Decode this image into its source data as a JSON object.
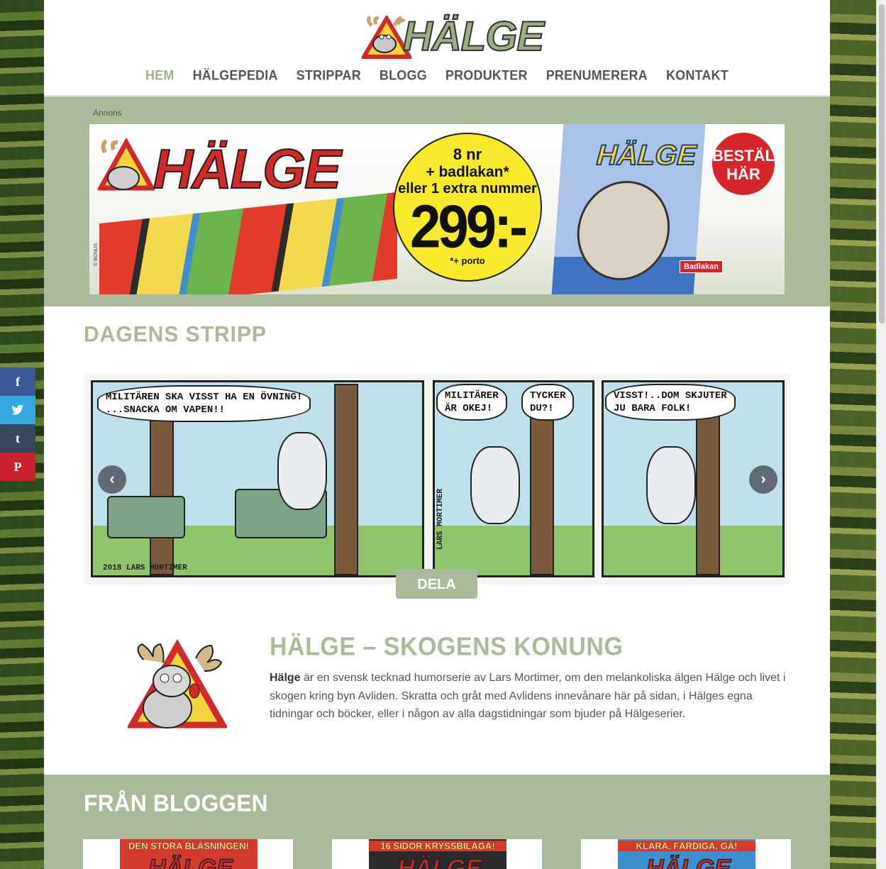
{
  "site": {
    "logo_text": "HÄLGE",
    "nav": [
      {
        "label": "HEM",
        "active": true
      },
      {
        "label": "HÄLGEPEDIA",
        "active": false
      },
      {
        "label": "STRIPPAR",
        "active": false
      },
      {
        "label": "BLOGG",
        "active": false
      },
      {
        "label": "PRODUKTER",
        "active": false
      },
      {
        "label": "PRENUMERERA",
        "active": false
      },
      {
        "label": "KONTAKT",
        "active": false
      }
    ]
  },
  "ad": {
    "label": "Annons",
    "logo_text": "HÄLGE",
    "offer_line1": "8 nr",
    "offer_line2": "+ badlakan*",
    "offer_line3": "eller 1 extra nummer",
    "price": "299:-",
    "porto": "*+ porto",
    "towel_text": "HÄLGE",
    "order_line1": "BESTÄLL",
    "order_line2": "HÄR",
    "badlakan": "Badlakan",
    "copyright": "© BONUS"
  },
  "strip": {
    "title": "DAGENS  STRIPP",
    "panel1_bubble": "MILITÄREN SKA VISST HA EN ÖVNING!\n...SNACKA OM VAPEN!!",
    "panel1_signature": "2018 LARS MORTIMER",
    "panel2_bubble1": "MILITÄRER\nÄR OKEJ!",
    "panel2_bubble2": "TYCKER\nDU?!",
    "panel2_signature": "LARS MORTIMER",
    "panel3_bubble": "VISST!..DOM SKJUTER\nJU BARA FOLK!",
    "share_label": "DELA",
    "prev": "‹",
    "next": "›"
  },
  "about": {
    "title": "HÄLGE – SKOGENS KONUNG",
    "lead": "Hälge",
    "text": " är en svensk tecknad humorserie av Lars Mortimer, om den melankoliska älgen Hälge och livet i skogen kring byn Avliden. Skratta och gråt med Avlidens innevånare här på sidan, i Hälges egna tidningar och böcker, eller i någon av alla  dagstidningar som bjuder på Hälgeserier."
  },
  "blog": {
    "title": "FRÅN BLOGGEN",
    "posts": [
      {
        "headline": "DEN STORA BLÅSNINGEN!",
        "logo": "HÄLGE",
        "color": "#d43a2c"
      },
      {
        "headline": "16 SIDOR KRYSSBILAGA!",
        "logo": "HÄLGE",
        "color": "#b8312a"
      },
      {
        "headline": "KLARA, FÄRDIGA, GÅ!",
        "logo": "HÄLGE",
        "color": "#d63a2e"
      }
    ]
  },
  "social": [
    {
      "icon": "facebook-icon",
      "glyph": "f"
    },
    {
      "icon": "twitter-icon",
      "glyph": "🐦"
    },
    {
      "icon": "tumblr-icon",
      "glyph": "t"
    },
    {
      "icon": "pinterest-icon",
      "glyph": "P"
    }
  ],
  "colors": {
    "accent": "#a9bb98",
    "nav_text": "#555555",
    "ad_red": "#d7262a",
    "ad_yellow": "#f7ea2a"
  }
}
